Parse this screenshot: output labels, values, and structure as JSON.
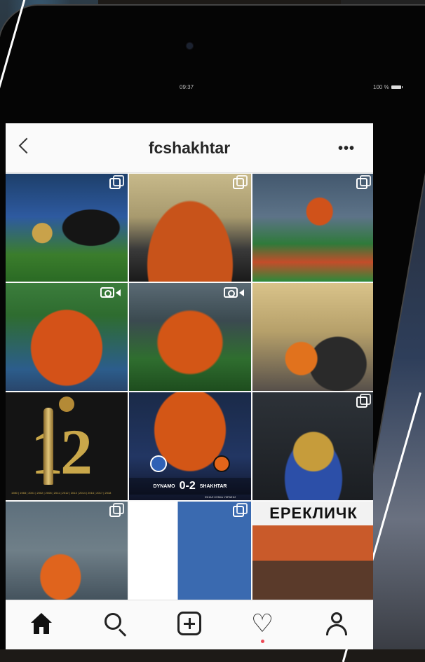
{
  "status_bar": {
    "time": "09:37",
    "battery": "100 %"
  },
  "header": {
    "username": "fcshakhtar",
    "more_label": "•••"
  },
  "grid": {
    "tiles": [
      {
        "badge": "multi"
      },
      {
        "badge": "multi"
      },
      {
        "badge": "multi"
      },
      {
        "badge": "video"
      },
      {
        "badge": "video"
      },
      {
        "badge": "none"
      },
      {
        "badge": "none",
        "big_number": "12",
        "years": "1980 | 1983 | 2001 | 2002 | 2008 | 2011 | 2012 | 2013 | 2014 | 2016 | 2017 | 2018"
      },
      {
        "badge": "none",
        "home_team": "DYNAMO",
        "score": "0-2",
        "away_team": "SHAKHTAR",
        "subtitle": "ФІНАЛ КУБКА УКРАЇНИ"
      },
      {
        "badge": "multi"
      },
      {
        "badge": "multi"
      },
      {
        "badge": "multi"
      },
      {
        "badge": "none",
        "banner": "ЕРЕКЛИЧК"
      }
    ]
  },
  "nav": {
    "items": [
      "home-icon",
      "search-icon",
      "add-post-icon",
      "heart-icon",
      "profile-icon"
    ],
    "activity_color": "#ed4956"
  }
}
